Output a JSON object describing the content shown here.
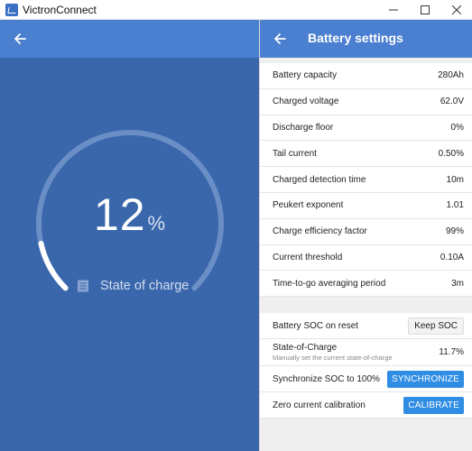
{
  "window": {
    "app_title": "VictronConnect",
    "icon": "victron-app-icon"
  },
  "window_controls": [
    "minimize-icon",
    "maximize-icon",
    "close-icon"
  ],
  "left": {
    "back_icon": "arrow-left-icon",
    "soc_value": "12",
    "soc_unit": "%",
    "soc_fraction": 0.12,
    "soc_label": "State of charge",
    "soc_label_icon": "battery-list-icon",
    "colors": {
      "background": "#3a67ac",
      "header": "#4b7fd0",
      "arc_track": "#6a8fc6",
      "arc_fill": "#ffffff"
    }
  },
  "right": {
    "back_icon": "arrow-left-icon",
    "title": "Battery settings",
    "settings": [
      {
        "label": "Battery capacity",
        "value": "280Ah"
      },
      {
        "label": "Charged voltage",
        "value": "62.0V"
      },
      {
        "label": "Discharge floor",
        "value": "0%"
      },
      {
        "label": "Tail current",
        "value": "0.50%"
      },
      {
        "label": "Charged detection time",
        "value": "10m"
      },
      {
        "label": "Peukert exponent",
        "value": "1.01"
      },
      {
        "label": "Charge efficiency factor",
        "value": "99%"
      },
      {
        "label": "Current threshold",
        "value": "0.10A"
      },
      {
        "label": "Time-to-go averaging period",
        "value": "3m"
      }
    ],
    "actions": {
      "soc_on_reset": {
        "label": "Battery SOC on reset",
        "button": "Keep SOC"
      },
      "state_of_charge": {
        "label": "State-of-Charge",
        "sublabel": "Manually set the current state-of-charge",
        "value": "11.7%"
      },
      "sync": {
        "label": "Synchronize SOC to 100%",
        "button": "SYNCHRONIZE"
      },
      "zero_cal": {
        "label": "Zero current calibration",
        "button": "CALIBRATE"
      }
    },
    "colors": {
      "accent": "#2f8de4",
      "header": "#4b7fd0"
    }
  }
}
